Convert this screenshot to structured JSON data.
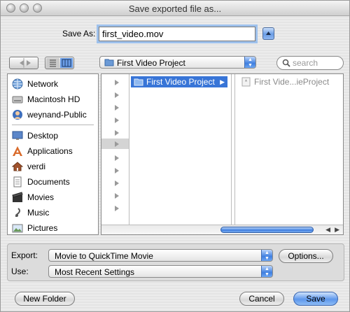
{
  "window": {
    "title": "Save exported file as..."
  },
  "save_as": {
    "label": "Save As:",
    "filename": "first_video.mov"
  },
  "toolbar": {
    "location": "First Video Project",
    "search_placeholder": "search"
  },
  "sidebar": {
    "devices": [
      {
        "label": "Network",
        "icon": "network-globe-icon"
      },
      {
        "label": "Macintosh HD",
        "icon": "hard-disk-icon"
      },
      {
        "label": "weynand-Public",
        "icon": "public-share-icon"
      }
    ],
    "places": [
      {
        "label": "Desktop",
        "icon": "desktop-icon"
      },
      {
        "label": "Applications",
        "icon": "applications-icon"
      },
      {
        "label": "verdi",
        "icon": "home-icon"
      },
      {
        "label": "Documents",
        "icon": "documents-icon"
      },
      {
        "label": "Movies",
        "icon": "movies-icon"
      },
      {
        "label": "Music",
        "icon": "music-icon"
      },
      {
        "label": "Pictures",
        "icon": "pictures-icon"
      }
    ]
  },
  "browser": {
    "selected_folder": "First Video Project",
    "preview_item": "First Vide...ieProject"
  },
  "export": {
    "label": "Export:",
    "value": "Movie to QuickTime Movie",
    "options_button": "Options..."
  },
  "use": {
    "label": "Use:",
    "value": "Most Recent Settings"
  },
  "buttons": {
    "new_folder": "New Folder",
    "cancel": "Cancel",
    "save": "Save"
  },
  "colors": {
    "selection": "#3875d7",
    "accent": "#5d97ec"
  }
}
